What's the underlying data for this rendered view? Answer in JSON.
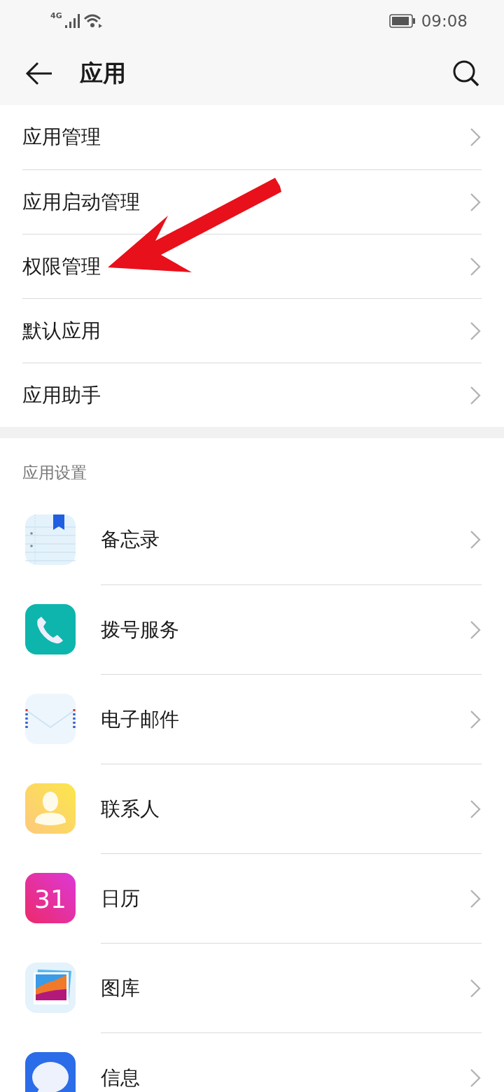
{
  "status_bar": {
    "network": "4G",
    "time": "09:08"
  },
  "header": {
    "title": "应用"
  },
  "menu": [
    {
      "label": "应用管理",
      "annotated": false
    },
    {
      "label": "应用启动管理",
      "annotated": false
    },
    {
      "label": "权限管理",
      "annotated": true
    },
    {
      "label": "默认应用",
      "annotated": false
    },
    {
      "label": "应用助手",
      "annotated": false
    }
  ],
  "app_settings": {
    "heading": "应用设置",
    "apps": [
      {
        "label": "备忘录",
        "kind": "memo"
      },
      {
        "label": "拨号服务",
        "kind": "phone"
      },
      {
        "label": "电子邮件",
        "kind": "mail"
      },
      {
        "label": "联系人",
        "kind": "contacts"
      },
      {
        "label": "日历",
        "kind": "calendar",
        "icon_text": "31"
      },
      {
        "label": "图库",
        "kind": "gallery"
      },
      {
        "label": "信息",
        "kind": "messages"
      }
    ]
  }
}
